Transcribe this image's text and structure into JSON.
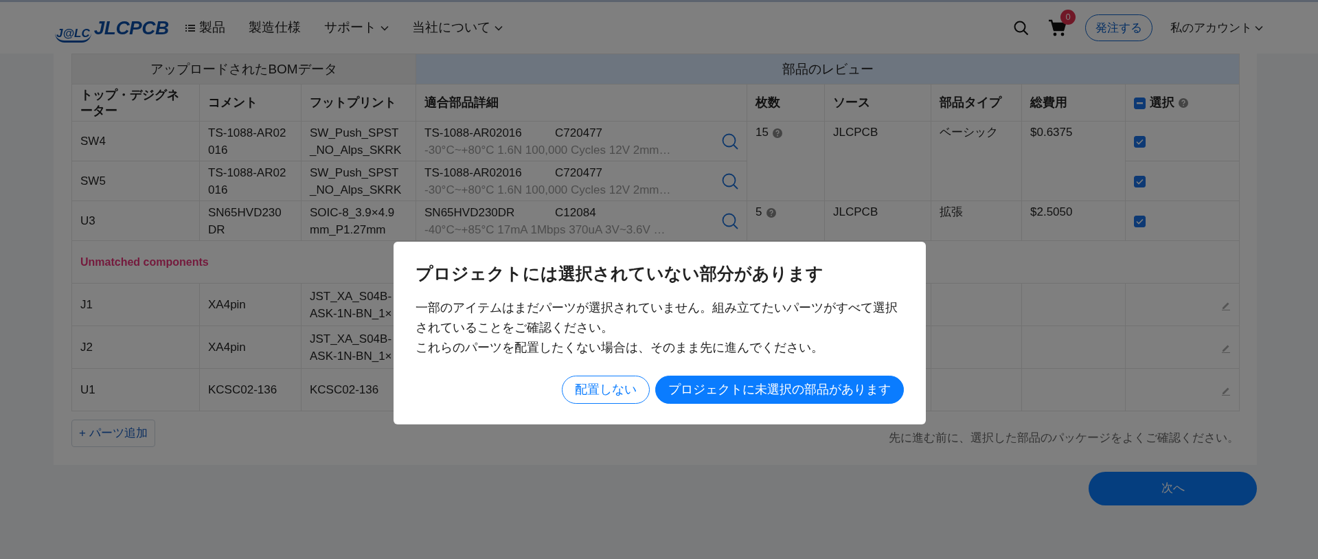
{
  "nav": {
    "logo_badge": "J@LC",
    "logo_text": "JLCPCB",
    "menu": [
      {
        "label": "製品",
        "kind": "list"
      },
      {
        "label": "製造仕様",
        "kind": "plain"
      },
      {
        "label": "サポート",
        "kind": "dropdown"
      },
      {
        "label": "当社について",
        "kind": "dropdown"
      }
    ],
    "cart_count": "0",
    "order_button": "発注する",
    "account": "私のアカウント"
  },
  "bom": {
    "uploaded_header": "アップロードされたBOMデータ",
    "review_header": "部品のレビュー",
    "columns": [
      "トップ・デジグネーター",
      "コメント",
      "フットプリント",
      "適合部品詳細",
      "枚数",
      "ソース",
      "部品タイプ",
      "総費用",
      "選択"
    ],
    "select_all_partial": true,
    "groups": [
      {
        "quantity": "15",
        "source": "JLCPCB",
        "part_type": "ベーシック",
        "total": "$0.6375",
        "parts": [
          {
            "designator": "SW4",
            "comment": "TS-1088-AR02016",
            "footprint": "SW_Push_SPST_NO_Alps_SKRK",
            "part_number": "TS-1088-AR02016",
            "lcsc": "C720477",
            "description": "-30°C~+80°C 1.6N 100,000 Cycles 12V 2mm…",
            "selected": true
          },
          {
            "designator": "SW5",
            "comment": "TS-1088-AR02016",
            "footprint": "SW_Push_SPST_NO_Alps_SKRK",
            "part_number": "TS-1088-AR02016",
            "lcsc": "C720477",
            "description": "-30°C~+80°C 1.6N 100,000 Cycles 12V 2mm…",
            "selected": true
          }
        ]
      },
      {
        "quantity": "5",
        "source": "JLCPCB",
        "part_type": "拡張",
        "total": "$2.5050",
        "parts": [
          {
            "designator": "U3",
            "comment": "SN65HVD230DR",
            "footprint": "SOIC-8_3.9×4.9mm_P1.27mm",
            "part_number": "SN65HVD230DR",
            "lcsc": "C12084",
            "description": "-40°C~+85°C 17mA 1Mbps 370uA 3V~3.6V …",
            "selected": true
          }
        ]
      }
    ],
    "unmatched_title": "Unmatched components",
    "unmatched": [
      {
        "designator": "J1",
        "comment": "XA4pin",
        "footprint": "JST_XA_S04B-ASK-1N-BN_1×"
      },
      {
        "designator": "J2",
        "comment": "XA4pin",
        "footprint": "JST_XA_S04B-ASK-1N-BN_1×"
      },
      {
        "designator": "U1",
        "comment": "KCSC02-136",
        "footprint": "KCSC02-136"
      }
    ],
    "add_button": "+ パーツ追加",
    "note": "先に進む前に、選択した部品のパッケージをよくご確認ください。"
  },
  "next_button": "次へ",
  "modal": {
    "title": "プロジェクトには選択されていない部分があります",
    "paragraphs": [
      "一部のアイテムはまだパーツが選択されていません。組み立てたいパーツがすべて選択されていることをご確認ください。",
      "これらのパーツを配置したくない場合は、そのまま先に進んでください。"
    ],
    "buttons": [
      {
        "label": "配置しない",
        "kind": "outline"
      },
      {
        "label": "プロジェクトに未選択の部品があります",
        "kind": "primary"
      }
    ]
  }
}
